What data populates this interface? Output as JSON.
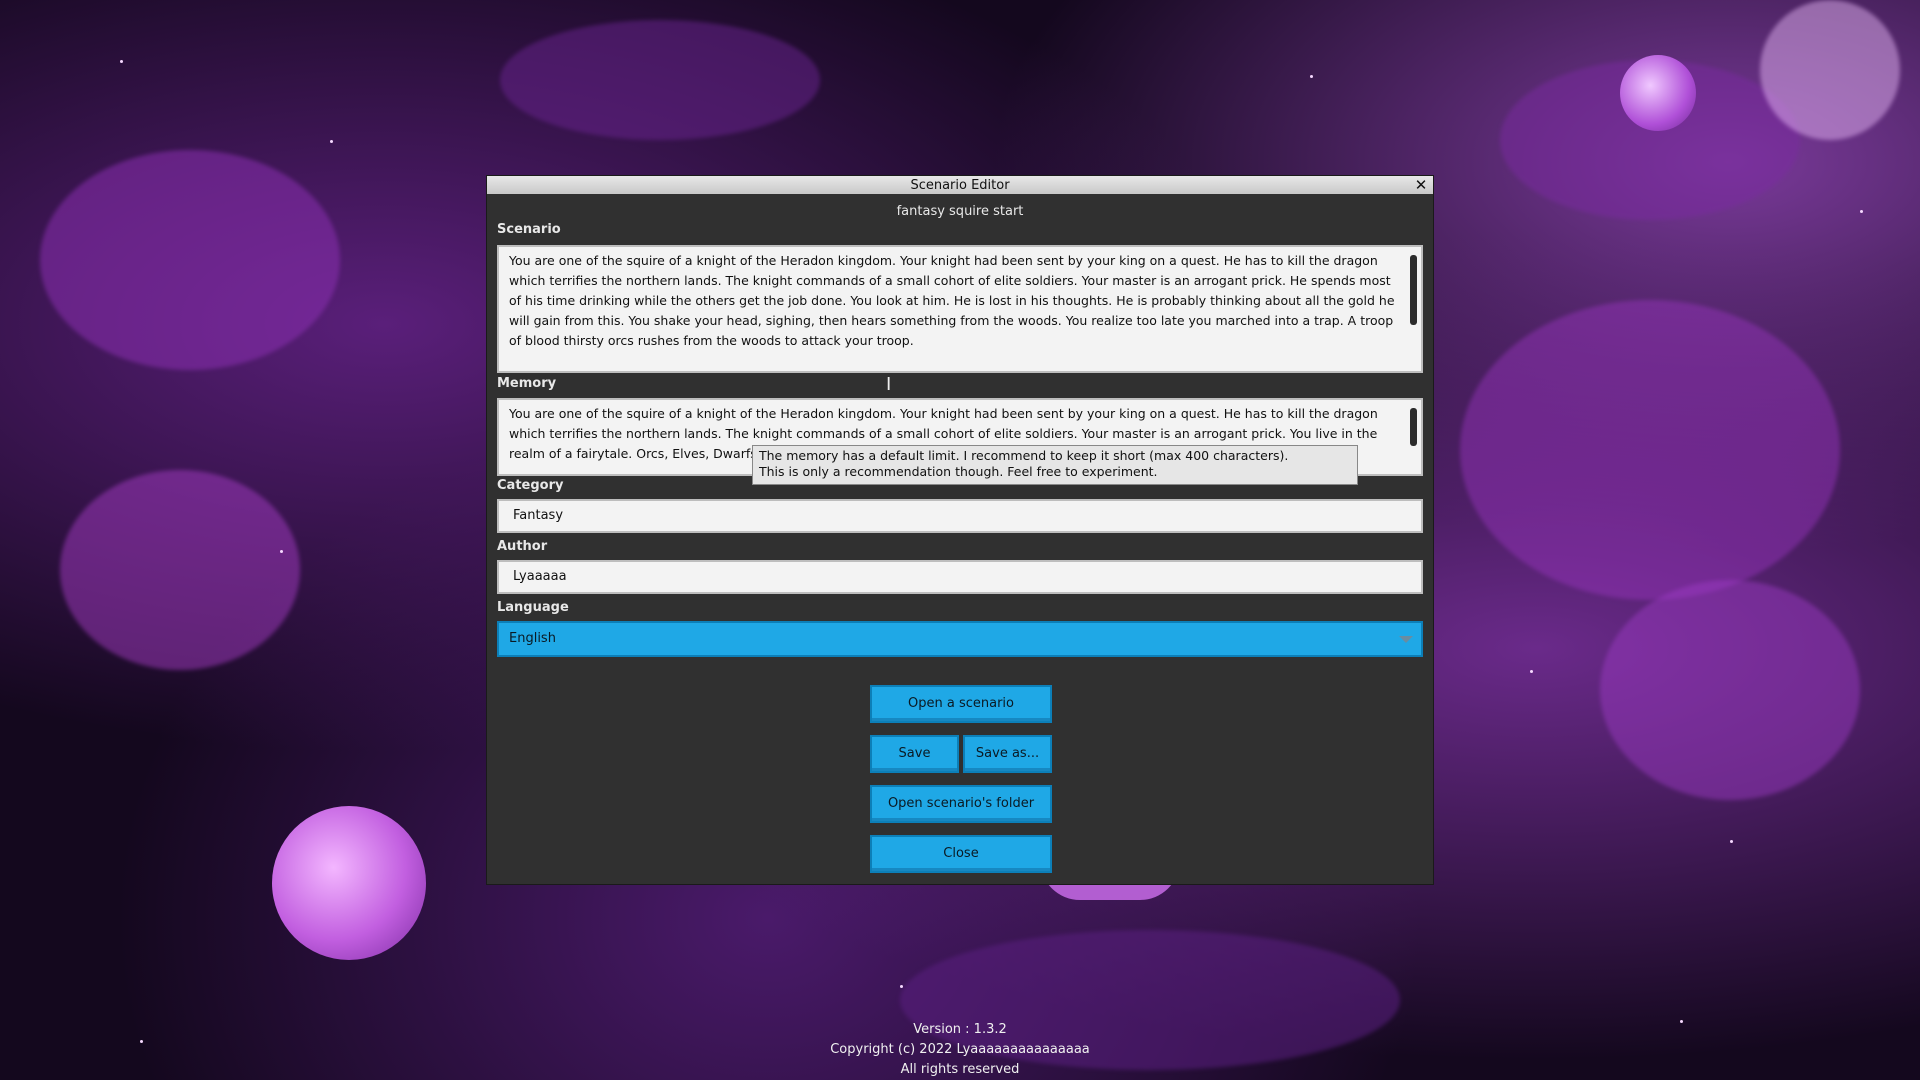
{
  "window": {
    "title": "Scenario Editor",
    "close_icon": "✕",
    "scenario_name": "fantasy squire start"
  },
  "scenario": {
    "label": "Scenario",
    "text": "You are one of the squire of a knight of the Heradon kingdom. Your knight had been sent by your king on a quest. He has to kill the dragon which terrifies the northern lands. The knight commands of a small cohort of elite soldiers. Your master is an arrogant prick. He spends most of his time drinking while the others get the job done. You look at him. He is lost in his thoughts. He is probably thinking about all the gold he will gain from this. You shake your head, sighing, then hears something from the woods. You realize too late you marched into a trap.  A troop of blood thirsty orcs rushes from the woods to attack your troop."
  },
  "memory": {
    "label": "Memory",
    "text": "You are one of the squire of a knight of the Heradon kingdom. Your knight had been sent by your king on a quest. He has to kill the dragon which terrifies the northern lands. The knight commands of a small cohort of elite soldiers. Your master is an arrogant prick. You live in the realm of a fairytale. Orcs, Elves, Dwarfs, Dragons are \"common\" things.",
    "tooltip_line1": "The memory has a default limit. I recommend to keep it short (max 400 characters).",
    "tooltip_line2": "This is only a recommendation though. Feel free to experiment."
  },
  "category": {
    "label": "Category",
    "value": "Fantasy"
  },
  "author": {
    "label": "Author",
    "value": "Lyaaaaa"
  },
  "language": {
    "label": "Language",
    "value": "English"
  },
  "buttons": {
    "open_scenario": "Open a scenario",
    "save": "Save",
    "save_as": "Save as...",
    "open_folder": "Open scenario's folder",
    "close": "Close"
  },
  "footer": {
    "version": "Version : 1.3.2",
    "copyright": "Copyright (c) 2022 Lyaaaaaaaaaaaaaaa",
    "rights": "All rights reserved"
  },
  "colors": {
    "accent": "#1fa8e6",
    "panel": "#303030",
    "background": "#14081e"
  }
}
